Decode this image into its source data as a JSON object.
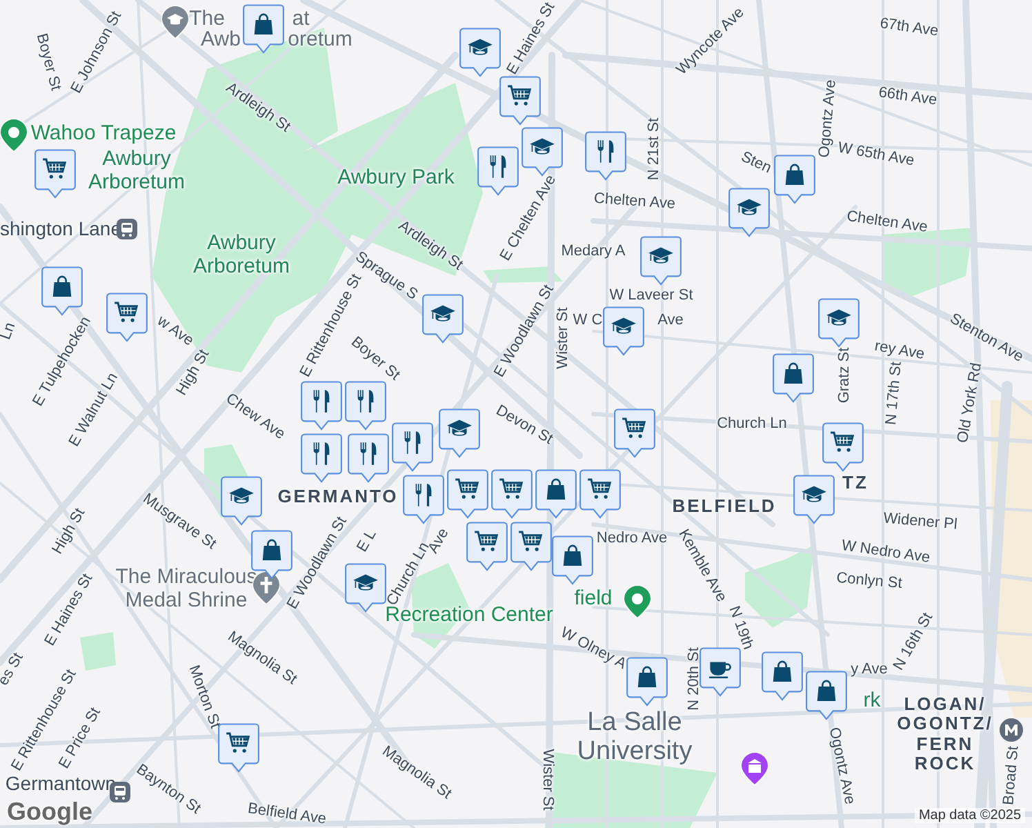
{
  "map": {
    "labels": [
      {
        "kind": "street",
        "text": "Boyer St"
      },
      {
        "kind": "street",
        "text": "E Johnson St"
      },
      {
        "kind": "poi",
        "text": "The"
      },
      {
        "kind": "poi",
        "text": "at"
      },
      {
        "kind": "poi",
        "text": "Awb"
      },
      {
        "kind": "poi",
        "text": "oretum"
      },
      {
        "kind": "street",
        "text": "Ardleigh St"
      },
      {
        "kind": "street",
        "text": "E Haines St"
      },
      {
        "kind": "poi_green",
        "text": "Wahoo Trapeze"
      },
      {
        "kind": "park",
        "text": "Awbury Arboretum"
      },
      {
        "kind": "park",
        "text": "Awbury Park"
      },
      {
        "kind": "transit",
        "text": "shington Lane"
      },
      {
        "kind": "park",
        "text": "Awbury Arboretum"
      },
      {
        "kind": "street",
        "text": "Ardleigh St"
      },
      {
        "kind": "street",
        "text": "E Chelten Ave"
      },
      {
        "kind": "street",
        "text": "Sprague S"
      },
      {
        "kind": "street",
        "text": "E Woodlawn St"
      },
      {
        "kind": "street",
        "text": "E Tulpehocken"
      },
      {
        "kind": "street",
        "text": "w Ave"
      },
      {
        "kind": "street",
        "text": "Ln"
      },
      {
        "kind": "street",
        "text": "E Walnut Ln"
      },
      {
        "kind": "street",
        "text": "High St"
      },
      {
        "kind": "street",
        "text": "E Rittenhouse St"
      },
      {
        "kind": "street",
        "text": "Boyer St"
      },
      {
        "kind": "street",
        "text": "Chew Ave"
      },
      {
        "kind": "street",
        "text": "Devon St"
      },
      {
        "kind": "area",
        "text": "GERMANTO"
      },
      {
        "kind": "street",
        "text": "High St"
      },
      {
        "kind": "street",
        "text": "Musgrave St"
      },
      {
        "kind": "street",
        "text": "E Woodlawn St"
      },
      {
        "kind": "street",
        "text": "E L"
      },
      {
        "kind": "street",
        "text": "Ave"
      },
      {
        "kind": "poi",
        "text": "The Miraculous Medal Shrine"
      },
      {
        "kind": "street",
        "text": "Church Ln"
      },
      {
        "kind": "street",
        "text": "E Haines St"
      },
      {
        "kind": "street",
        "text": "Magnolia St"
      },
      {
        "kind": "street",
        "text": "Morton St"
      },
      {
        "kind": "street",
        "text": "es St"
      },
      {
        "kind": "street",
        "text": "E Rittenhouse St"
      },
      {
        "kind": "street",
        "text": "E Price St"
      },
      {
        "kind": "street",
        "text": "Magnolia St"
      },
      {
        "kind": "street",
        "text": "Baynton St"
      },
      {
        "kind": "transit",
        "text": "Germantown"
      },
      {
        "kind": "street",
        "text": "Belfield Ave"
      },
      {
        "kind": "brand",
        "text": "Google"
      },
      {
        "kind": "street",
        "text": "Wyncote Ave"
      },
      {
        "kind": "street",
        "text": "67th Ave"
      },
      {
        "kind": "street",
        "text": "66th Ave"
      },
      {
        "kind": "street",
        "text": "N 21st St"
      },
      {
        "kind": "street",
        "text": "W 65th Ave"
      },
      {
        "kind": "street",
        "text": "Sten"
      },
      {
        "kind": "street",
        "text": "Ogontz Ave"
      },
      {
        "kind": "street",
        "text": "Chelten Ave"
      },
      {
        "kind": "street",
        "text": "Chelten Ave"
      },
      {
        "kind": "street",
        "text": "Medary A"
      },
      {
        "kind": "street",
        "text": "W Laveer St"
      },
      {
        "kind": "street",
        "text": "W C"
      },
      {
        "kind": "street",
        "text": "Ave"
      },
      {
        "kind": "street",
        "text": "Wister St"
      },
      {
        "kind": "street",
        "text": "Gratz St"
      },
      {
        "kind": "street",
        "text": "rey Ave"
      },
      {
        "kind": "street",
        "text": "N 17th St"
      },
      {
        "kind": "street",
        "text": "Stenton Ave"
      },
      {
        "kind": "street",
        "text": "Old York Rd"
      },
      {
        "kind": "street",
        "text": "Church Ln"
      },
      {
        "kind": "area",
        "text": "BELFIELD"
      },
      {
        "kind": "area",
        "text": "TZ"
      },
      {
        "kind": "street",
        "text": "Widener Pl"
      },
      {
        "kind": "street",
        "text": "W Nedro Ave"
      },
      {
        "kind": "street",
        "text": "Nedro Ave"
      },
      {
        "kind": "street",
        "text": "Conlyn St"
      },
      {
        "kind": "street",
        "text": "Kemble Ave"
      },
      {
        "kind": "poi_green",
        "text": "field"
      },
      {
        "kind": "poi_green",
        "text": "Recreation Center"
      },
      {
        "kind": "street",
        "text": "W Olney A"
      },
      {
        "kind": "street",
        "text": "N 19th"
      },
      {
        "kind": "street",
        "text": "N 20th St"
      },
      {
        "kind": "street",
        "text": "y Ave"
      },
      {
        "kind": "street",
        "text": "N 16th St"
      },
      {
        "kind": "park",
        "text": "rk"
      },
      {
        "kind": "university",
        "text": "La Salle University"
      },
      {
        "kind": "area",
        "text": "LOGAN/ OGONTZ/ FERN ROCK"
      },
      {
        "kind": "street",
        "text": "Ogontz Ave"
      },
      {
        "kind": "street",
        "text": "Wister St"
      },
      {
        "kind": "street",
        "text": "Broad St"
      },
      {
        "kind": "attribution",
        "text": "Map data ©2025"
      }
    ],
    "pins": [
      {
        "kind": "shopping"
      },
      {
        "kind": "school"
      },
      {
        "kind": "grocery"
      },
      {
        "kind": "school"
      },
      {
        "kind": "restaurant"
      },
      {
        "kind": "restaurant"
      },
      {
        "kind": "grocery"
      },
      {
        "kind": "shopping"
      },
      {
        "kind": "school"
      },
      {
        "kind": "school"
      },
      {
        "kind": "shopping"
      },
      {
        "kind": "grocery"
      },
      {
        "kind": "school"
      },
      {
        "kind": "school"
      },
      {
        "kind": "school"
      },
      {
        "kind": "shopping"
      },
      {
        "kind": "restaurant"
      },
      {
        "kind": "restaurant"
      },
      {
        "kind": "restaurant"
      },
      {
        "kind": "restaurant"
      },
      {
        "kind": "grocery"
      },
      {
        "kind": "school"
      },
      {
        "kind": "restaurant"
      },
      {
        "kind": "restaurant"
      },
      {
        "kind": "grocery"
      },
      {
        "kind": "school"
      },
      {
        "kind": "grocery"
      },
      {
        "kind": "grocery"
      },
      {
        "kind": "shopping"
      },
      {
        "kind": "grocery"
      },
      {
        "kind": "grocery"
      },
      {
        "kind": "grocery"
      },
      {
        "kind": "school"
      },
      {
        "kind": "shopping"
      },
      {
        "kind": "school"
      },
      {
        "kind": "shopping"
      },
      {
        "kind": "shopping"
      },
      {
        "kind": "cafe"
      },
      {
        "kind": "shopping"
      },
      {
        "kind": "shopping"
      },
      {
        "kind": "grocery"
      }
    ]
  }
}
